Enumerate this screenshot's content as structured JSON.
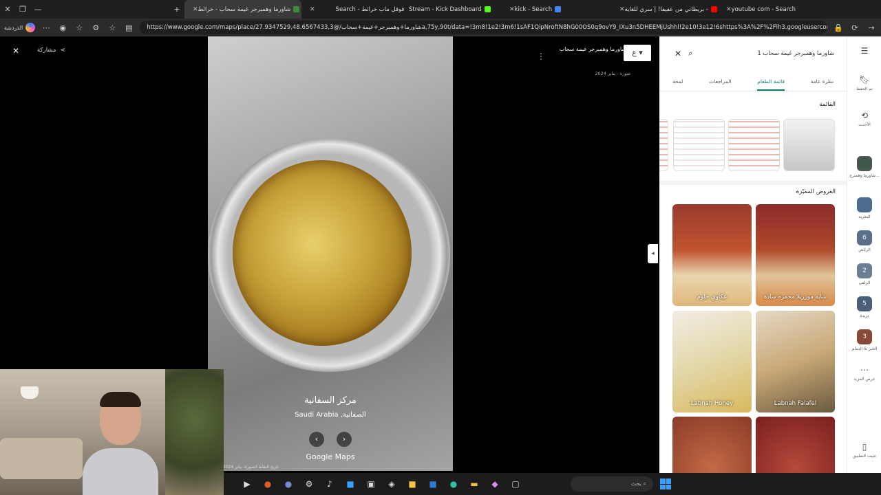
{
  "browser": {
    "tabs": [
      {
        "label": "شاورما وهمبرجر غيمة سحاب - خرائط",
        "active": true,
        "color": "#3c8c3c"
      },
      {
        "label": "Search - قوقل ماب خرائط",
        "active": false,
        "color": "#4285f4"
      },
      {
        "label": "Stream - Kick Dashboard",
        "active": false,
        "color": "#53fc18"
      },
      {
        "label": "kick - Search",
        "active": false,
        "color": "#53fc18"
      },
      {
        "label": "بريطاني من عفيفا! | سري للغاية -",
        "active": false,
        "color": "#ff0000"
      },
      {
        "label": "youtube com - Search",
        "active": false,
        "color": "#4285f4"
      }
    ],
    "url": "https://www.google.com/maps/place/شاورما+وهمبرجر+غيمة+سحاب/@27.9347529,48.6567433,3a,75y,90t/data=!3m8!1e2!3m6!1sAF1QipNroftN8hG00OS0q9ovY9_IXu3n5DHEEMjUshhl!2e10!3e12!6shttps%3A%2F%2Flh3.googleusercon...",
    "profile_label": "الدردشة"
  },
  "viewer": {
    "close_label": "✕",
    "share_label": "مشاركة",
    "place_name": "شاورما وهمبرجر غيمة سحاب",
    "photo_date": "صورة - يناير 2024",
    "lang_label": "ع",
    "location_title": "مركز السفانية",
    "location_sub": "Saudi Arabia ,الصفانية",
    "branding": "Google Maps",
    "capture_date": "تاريخ التقاط الصورة: يناير 2024"
  },
  "panel": {
    "search_text": "شاورما وهمبرجر غيمة سحاب 1",
    "tabs": [
      "لمحة",
      "المراجعات",
      "قائمة الطعام",
      "نظرة عامة"
    ],
    "active_tab": "قائمة الطعام",
    "menu_title": "القائمة",
    "featured_title": "العروض المميّزة",
    "dishes": [
      {
        "label": "شابه موزريلا محمره سادة",
        "colors": [
          "#8c2b2b",
          "#d98a4a"
        ]
      },
      {
        "label": "عكاوي حلوم",
        "colors": [
          "#9a3a2e",
          "#e0b77a"
        ]
      },
      {
        "label": "Labnah Falafel",
        "colors": [
          "#e5d8c4",
          "#b68a4e"
        ]
      },
      {
        "label": "Labnah Honey",
        "colors": [
          "#f1ede4",
          "#d8b85e"
        ]
      },
      {
        "label": "",
        "colors": [
          "#7a1f1f",
          "#b54a3a"
        ]
      },
      {
        "label": "",
        "colors": [
          "#c46a46",
          "#8a3b28"
        ]
      }
    ]
  },
  "rail": {
    "items": [
      {
        "label": "تم الحفظ",
        "icon": "bookmark-icon"
      },
      {
        "label": "الأحدث",
        "icon": "history-icon"
      },
      {
        "label": "شاورما وهمبرج...",
        "icon": "thumb",
        "badge": ""
      },
      {
        "label": "البحرية",
        "icon": "thumb",
        "badge": ""
      },
      {
        "label": "الرياض",
        "icon": "thumb",
        "badge": "6"
      },
      {
        "label": "الزلفي",
        "icon": "thumb",
        "badge": "2"
      },
      {
        "label": "بريدة",
        "icon": "thumb",
        "badge": "5"
      },
      {
        "label": "الخبر & الدمام",
        "icon": "thumb",
        "badge": "3"
      },
      {
        "label": "عرض المزيد",
        "icon": "more-icon"
      },
      {
        "label": "تثبيت التطبيق",
        "icon": "phone-icon"
      }
    ]
  },
  "taskbar": {
    "search_placeholder": "بحث"
  }
}
